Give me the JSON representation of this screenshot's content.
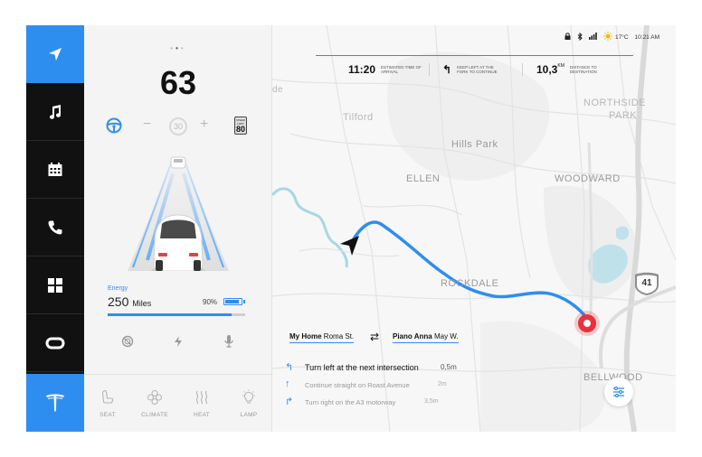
{
  "sidebar": {
    "items": [
      {
        "icon": "navigation-icon",
        "active": true
      },
      {
        "icon": "music-icon",
        "active": false
      },
      {
        "icon": "calendar-icon",
        "active": false
      },
      {
        "icon": "phone-icon",
        "active": false
      },
      {
        "icon": "apps-grid-icon",
        "active": false
      },
      {
        "icon": "camera-icon",
        "active": false
      },
      {
        "icon": "tesla-logo-icon",
        "active": true
      }
    ]
  },
  "car": {
    "page_dots": [
      "•",
      "•",
      "•"
    ],
    "speed": "63",
    "cruise_minus": "−",
    "cruise_plus": "+",
    "set_speed": "30",
    "speed_limit": {
      "label": "SPEED LIMIT",
      "value": "80"
    },
    "energy": {
      "title": "Energy",
      "miles": "250",
      "unit": "Miles",
      "percent_label": "90%",
      "percent": 0.9
    }
  },
  "climate": {
    "items": [
      {
        "label": "SEAT",
        "icon": "seat-icon"
      },
      {
        "label": "CLIMATE",
        "icon": "fan-icon"
      },
      {
        "label": "HEAT",
        "icon": "heat-icon"
      },
      {
        "label": "LAMP",
        "icon": "lamp-icon"
      }
    ]
  },
  "status": {
    "temperature": "17°C",
    "time": "10:21 AM"
  },
  "navigation": {
    "eta": {
      "value": "11:20",
      "label": "ESTIMATED TIME OF ARRIVAL"
    },
    "next_turn": {
      "arrow": "↰",
      "label": "KEEP LEFT AT THE FORK TO CONTINUE"
    },
    "distance": {
      "value": "10,3",
      "unit": "KM",
      "label": "DISTANCE TO DESTINATION"
    }
  },
  "map": {
    "labels": [
      "Tilford",
      "Hills Park",
      "ELLEN",
      "WOODWARD",
      "NORTHSIDE",
      "PARK",
      "ROCKDALE",
      "BELLWOOD",
      "de"
    ],
    "highway_shield": "41"
  },
  "route": {
    "from": {
      "name": "My Home",
      "street": "Roma St."
    },
    "swap": "⇄",
    "to": {
      "name": "Piano Anna",
      "street": "May W."
    }
  },
  "directions": [
    {
      "arrow": "↰",
      "text": "Turn left at the next intersection",
      "distance": "0,5m"
    },
    {
      "arrow": "↑",
      "text": "Continue straight on Roast Avenue",
      "distance": "2m"
    },
    {
      "arrow": "↱",
      "text": "Turn right on the A3 motorway",
      "distance": "3,5m"
    }
  ],
  "colors": {
    "accent": "#2e8ef0",
    "destination": "#e8323c",
    "rail": "#111111"
  }
}
